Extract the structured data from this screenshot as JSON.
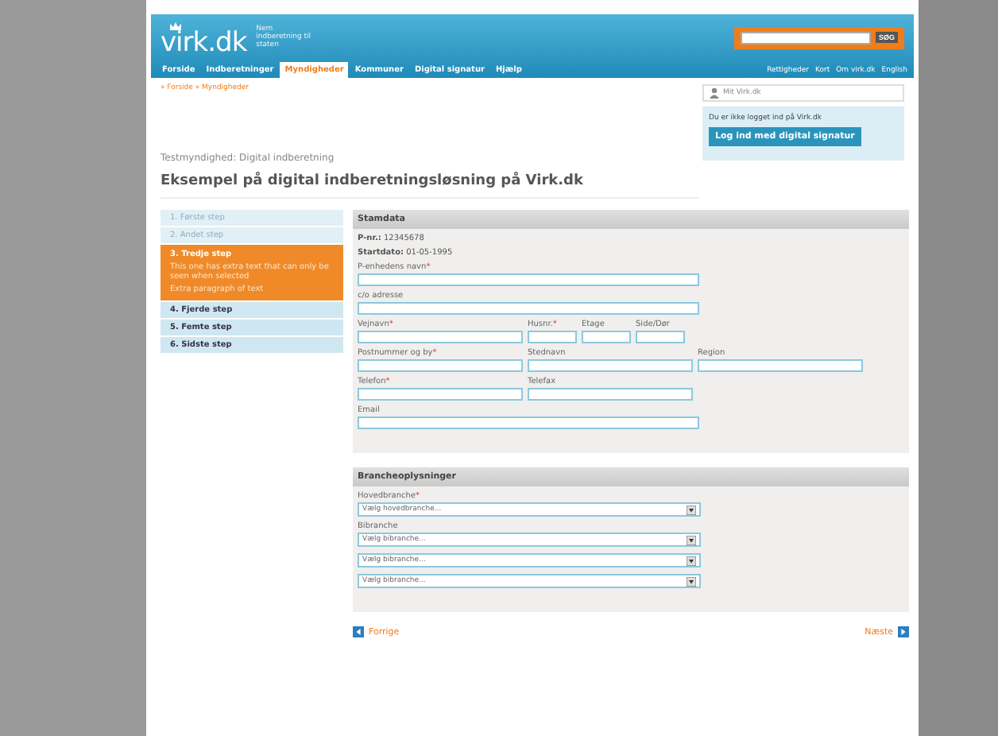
{
  "header": {
    "logo": "virk.dk",
    "tagline": "Nem indberetning til staten",
    "search": {
      "button": "SØG"
    },
    "nav": [
      {
        "label": "Forside",
        "selected": false
      },
      {
        "label": "Indberetninger",
        "selected": false
      },
      {
        "label": "Myndigheder",
        "selected": true
      },
      {
        "label": "Kommuner",
        "selected": false
      },
      {
        "label": "Digital signatur",
        "selected": false
      },
      {
        "label": "Hjælp",
        "selected": false
      }
    ],
    "util_links": [
      "Rettigheder",
      "Kort",
      "Om virk.dk",
      "English"
    ]
  },
  "breadcrumb": "» Forside » Myndigheder",
  "login_panel": {
    "title": "Mit Virk.dk",
    "text": "Du er ikke logget ind på Virk.dk",
    "button": "Log ind med digital signatur"
  },
  "subtitle": "Testmyndighed: Digital indberetning",
  "title": "Eksempel på digital indberetningsløsning på Virk.dk",
  "steps": [
    {
      "label": "1.  Første step",
      "done": true,
      "selected": false
    },
    {
      "label": "2.  Andet step",
      "done": true,
      "selected": false
    },
    {
      "label": "3.  Tredje step",
      "done": false,
      "selected": true,
      "details": [
        "This one has extra text that can only be seen when selected",
        "Extra paragraph of text"
      ]
    },
    {
      "label": "4.  Fjerde step",
      "done": false,
      "selected": false
    },
    {
      "label": "5.  Femte step",
      "done": false,
      "selected": false
    },
    {
      "label": "6.  Sidste step",
      "done": false,
      "selected": false
    }
  ],
  "stamdata": {
    "heading": "Stamdata",
    "facts": [
      {
        "label": "P-nr.:",
        "value": "12345678"
      },
      {
        "label": "Startdato:",
        "value": "01-05-1995"
      }
    ],
    "rows": [
      [
        {
          "label": "P-enhedens navn",
          "mark": "*",
          "kind": "wide"
        }
      ],
      [
        {
          "label": "c/o adresse",
          "kind": "wide"
        }
      ],
      [
        {
          "label": "Vejnavn",
          "mark": "*",
          "kind": "half"
        },
        {
          "label": "Husnr.",
          "mark": "*",
          "kind": "small"
        },
        {
          "label": "Etage",
          "kind": "small"
        },
        {
          "label": "Side/Dør",
          "kind": "small"
        }
      ],
      [
        {
          "label": "Postnummer og by",
          "mark": "*",
          "kind": "half"
        },
        {
          "label": "Stednavn",
          "kind": "half"
        },
        {
          "label": "Region",
          "kind": "half"
        }
      ],
      [
        {
          "label": "Telefon",
          "mark": "*",
          "kind": "half"
        },
        {
          "label": "Telefax",
          "kind": "half"
        }
      ],
      [
        {
          "label": "Email",
          "kind": "wide"
        }
      ]
    ]
  },
  "branche": {
    "heading": "Brancheoplysninger",
    "groups": [
      {
        "label": "Hovedbranche",
        "mark": "*",
        "selects": [
          "Vælg hovedbranche..."
        ]
      },
      {
        "label": "Bibranche",
        "selects": [
          "Vælg bibranche...",
          "Vælg bibranche...",
          "Vælg bibranche..."
        ]
      }
    ]
  },
  "pager": {
    "previous": "Forrige",
    "next": "Næste"
  }
}
